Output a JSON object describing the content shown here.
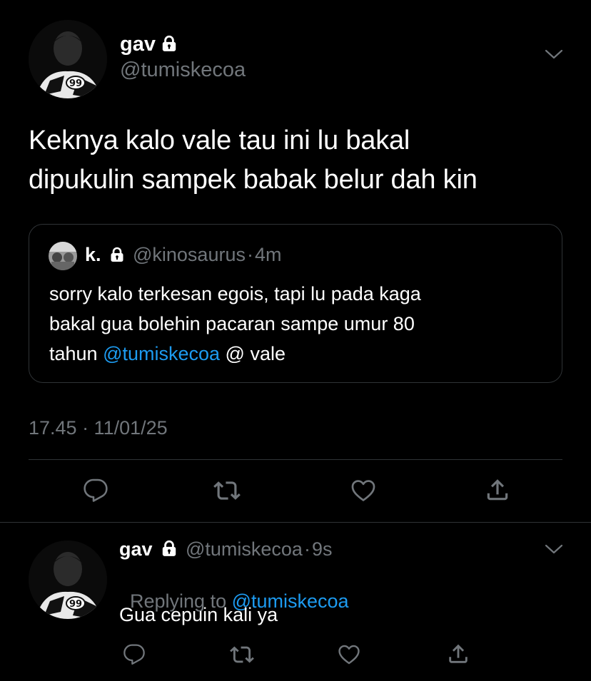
{
  "main_tweet": {
    "display_name": "gav",
    "handle": "@tumiskecoa",
    "text_line1": "Keknya kalo vale tau ini lu bakal",
    "text_line2": "dipukulin sampek babak belur dah kin",
    "timestamp": "17.45 · 11/01/25"
  },
  "quoted_tweet": {
    "display_name": "k.",
    "handle": "@kinosaurus",
    "separator": "·",
    "time": "4m",
    "line1": "sorry kalo terkesan egois, tapi lu pada kaga",
    "line2": "bakal gua bolehin pacaran sampe umur 80",
    "line3_prefix": "tahun ",
    "line3_mention": "@tumiskecoa",
    "line3_suffix": " @ vale"
  },
  "reply": {
    "display_name": "gav",
    "handle": "@tumiskecoa",
    "separator": "·",
    "time": "9s",
    "replying_prefix": "Replying to ",
    "replying_to": "@tumiskecoa",
    "text": "Gua cepuin kali ya"
  },
  "icons": {
    "lock": "lock-icon",
    "chevron": "chevron-down-icon",
    "reply": "reply-icon",
    "retweet": "retweet-icon",
    "like": "heart-icon",
    "share": "share-icon"
  },
  "colors": {
    "background": "#000000",
    "secondary_text": "#71767b",
    "link": "#1d9bf0",
    "border": "#2f3336"
  }
}
